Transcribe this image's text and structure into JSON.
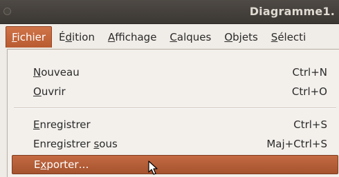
{
  "window": {
    "title": "Diagramme1."
  },
  "menubar": {
    "menus": [
      {
        "pre": "",
        "mn": "F",
        "post": "ichier"
      },
      {
        "pre": "É",
        "mn": "d",
        "post": "ition"
      },
      {
        "pre": "",
        "mn": "A",
        "post": "ffichage"
      },
      {
        "pre": "",
        "mn": "C",
        "post": "alques"
      },
      {
        "pre": "",
        "mn": "O",
        "post": "bjets"
      },
      {
        "pre": "",
        "mn": "S",
        "post": "électi"
      }
    ]
  },
  "file_menu": {
    "items": [
      {
        "pre": "",
        "mn": "N",
        "post": "ouveau",
        "accel": "Ctrl+N"
      },
      {
        "pre": "",
        "mn": "O",
        "post": "uvrir",
        "accel": "Ctrl+O"
      },
      {
        "pre": "",
        "mn": "E",
        "post": "nregistrer",
        "accel": "Ctrl+S"
      },
      {
        "pre": "Enregistrer ",
        "mn": "s",
        "post": "ous",
        "accel": "Maj+Ctrl+S"
      },
      {
        "pre": "E",
        "mn": "x",
        "post": "porter…",
        "accel": ""
      }
    ]
  },
  "colors": {
    "highlight": "#b85b30",
    "titlebar": "#3b3733"
  },
  "icons": {
    "cursor": "mouse-pointer-icon"
  }
}
